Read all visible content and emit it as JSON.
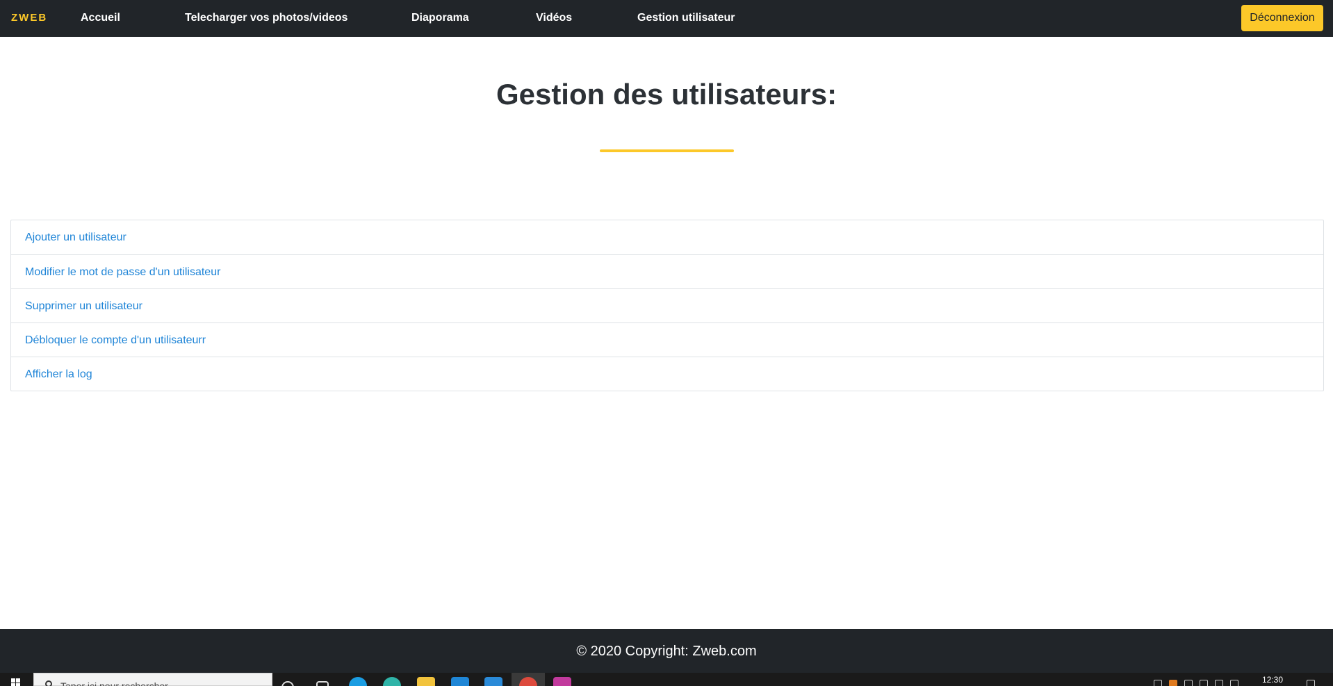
{
  "navbar": {
    "brand": "ZWEB",
    "links": [
      "Accueil",
      "Telecharger vos photos/videos",
      "Diaporama",
      "Vidéos",
      "Gestion utilisateur"
    ],
    "logout_label": "Déconnexion"
  },
  "main": {
    "title": "Gestion des utilisateurs:",
    "actions": [
      "Ajouter un utilisateur",
      "Modifier le mot de passe d'un utilisateur",
      "Supprimer un utilisateur",
      "Débloquer le compte d'un utilisateurr",
      "Afficher la log"
    ]
  },
  "footer": {
    "copyright": "© 2020 Copyright: Zweb.com"
  },
  "taskbar": {
    "search_placeholder": "Taper ici pour rechercher",
    "clock": "12:30",
    "icons": [
      "start-icon",
      "search-icon",
      "task-view-icon",
      "edge-icon",
      "edge-beta-icon",
      "file-explorer-icon",
      "store-icon",
      "vscode-icon",
      "chrome-icon",
      "feather-app-icon"
    ]
  },
  "colors": {
    "accent": "#fcc829",
    "navbar_bg": "#212529",
    "link": "#1e84d7"
  }
}
